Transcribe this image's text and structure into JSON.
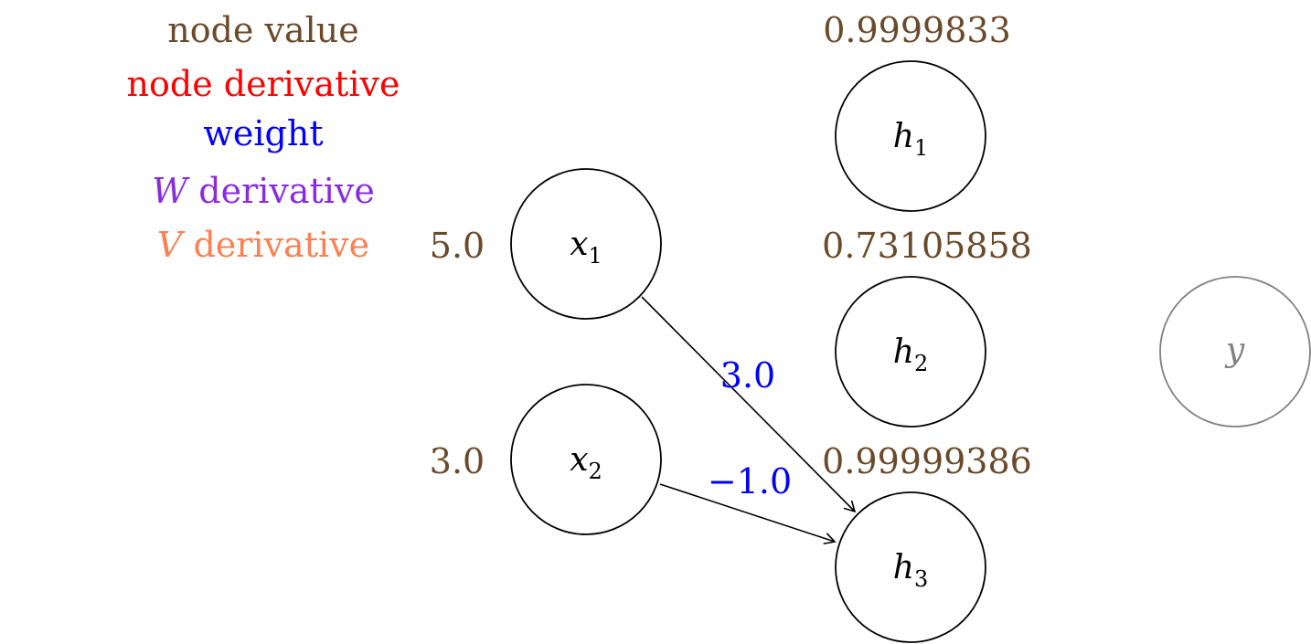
{
  "legend": {
    "node_value": "node value",
    "node_derivative": "node derivative",
    "weight": "weight",
    "w_derivative_symbol": "W",
    "w_derivative_word": "derivative",
    "v_derivative_symbol": "V",
    "v_derivative_word": "derivative"
  },
  "colors": {
    "node_value": "#6b4a2a",
    "node_derivative": "#ff0000",
    "weight": "#0000ff",
    "w_derivative": "#8a2be2",
    "v_derivative": "#ff7f50",
    "node_stroke": "#000000",
    "output_stroke": "#808080"
  },
  "inputs": [
    {
      "id": "x1",
      "symbol": "x",
      "subscript": "1",
      "value": "5.0"
    },
    {
      "id": "x2",
      "symbol": "x",
      "subscript": "2",
      "value": "3.0"
    }
  ],
  "hidden": [
    {
      "id": "h1",
      "symbol": "h",
      "subscript": "1",
      "value": "0.9999833"
    },
    {
      "id": "h2",
      "symbol": "h",
      "subscript": "2",
      "value": "0.73105858"
    },
    {
      "id": "h3",
      "symbol": "h",
      "subscript": "3",
      "value": "0.99999386"
    }
  ],
  "output": {
    "id": "y",
    "symbol": "y"
  },
  "edges": [
    {
      "from": "x1",
      "to": "h3",
      "weight": "3.0"
    },
    {
      "from": "x2",
      "to": "h3",
      "weight": "−1.0"
    }
  ]
}
